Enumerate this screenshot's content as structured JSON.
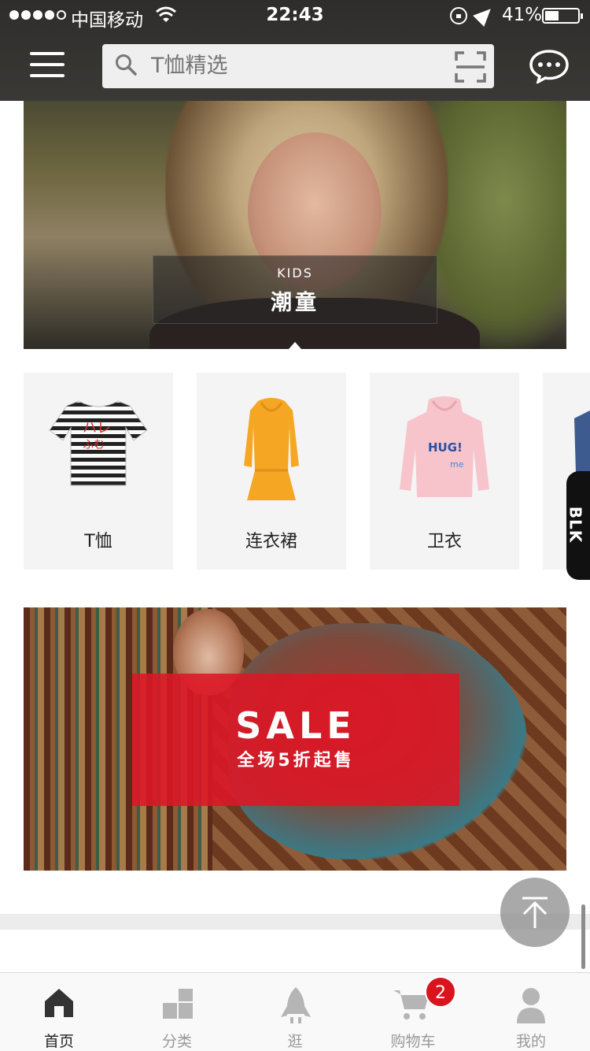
{
  "status_bar": {
    "carrier": "中国移动",
    "time": "22:43",
    "battery": "41%"
  },
  "header": {
    "search_placeholder": "T恤精选",
    "icons": [
      "menu-icon",
      "search-icon",
      "scan-icon",
      "chat-icon"
    ]
  },
  "kids_banner": {
    "english": "KIDS",
    "chinese": "潮童"
  },
  "categories": [
    {
      "label": "T恤",
      "icon": "tshirt-icon"
    },
    {
      "label": "连衣裙",
      "icon": "dress-icon"
    },
    {
      "label": "卫衣",
      "icon": "hoodie-icon"
    }
  ],
  "side_tab": {
    "label": "BLK"
  },
  "sale_banner": {
    "title": "SALE",
    "subtitle": "全场5折起售"
  },
  "back_to_top": {
    "icon": "arrow-up-icon"
  },
  "tabbar": {
    "tabs": [
      {
        "label": "首页",
        "icon": "home-icon",
        "active": true
      },
      {
        "label": "分类",
        "icon": "category-icon",
        "active": false
      },
      {
        "label": "逛",
        "icon": "rocket-icon",
        "active": false
      },
      {
        "label": "购物车",
        "icon": "cart-icon",
        "active": false,
        "badge": "2"
      },
      {
        "label": "我的",
        "icon": "profile-icon",
        "active": false
      }
    ]
  },
  "colors": {
    "header_bg": "#3b3936",
    "sale_red": "#de1626",
    "badge_red": "#d9141e"
  }
}
